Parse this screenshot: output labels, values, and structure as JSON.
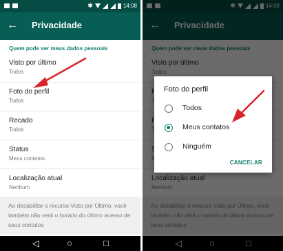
{
  "status_bar": {
    "time": "14:08"
  },
  "appbar": {
    "back_icon": "arrow-left-icon",
    "title": "Privacidade"
  },
  "section_label": "Quem pode ver meus dados pessoais",
  "settings": [
    {
      "label": "Visto por último",
      "value": "Todos"
    },
    {
      "label": "Foto do perfil",
      "value": "Todos"
    },
    {
      "label": "Recado",
      "value": "Todos"
    },
    {
      "label": "Status",
      "value": "Meus contatos"
    },
    {
      "label": "Localização atual",
      "value": "Nenhum"
    }
  ],
  "footer_note": "Ao desabilitar o recurso Visto por Último, você também não verá o horário do último acesso de seus contatos",
  "dialog": {
    "title": "Foto do perfil",
    "options": [
      {
        "label": "Todos",
        "selected": false
      },
      {
        "label": "Meus contatos",
        "selected": true
      },
      {
        "label": "Ninguém",
        "selected": false
      }
    ],
    "cancel_label": "CANCELAR"
  },
  "nav_icons": [
    "back-triangle-icon",
    "home-circle-icon",
    "recents-square-icon"
  ],
  "colors": {
    "statusbar": "#054d44",
    "appbar": "#075e54",
    "accent": "#14806f",
    "arrow": "#d8232a"
  }
}
